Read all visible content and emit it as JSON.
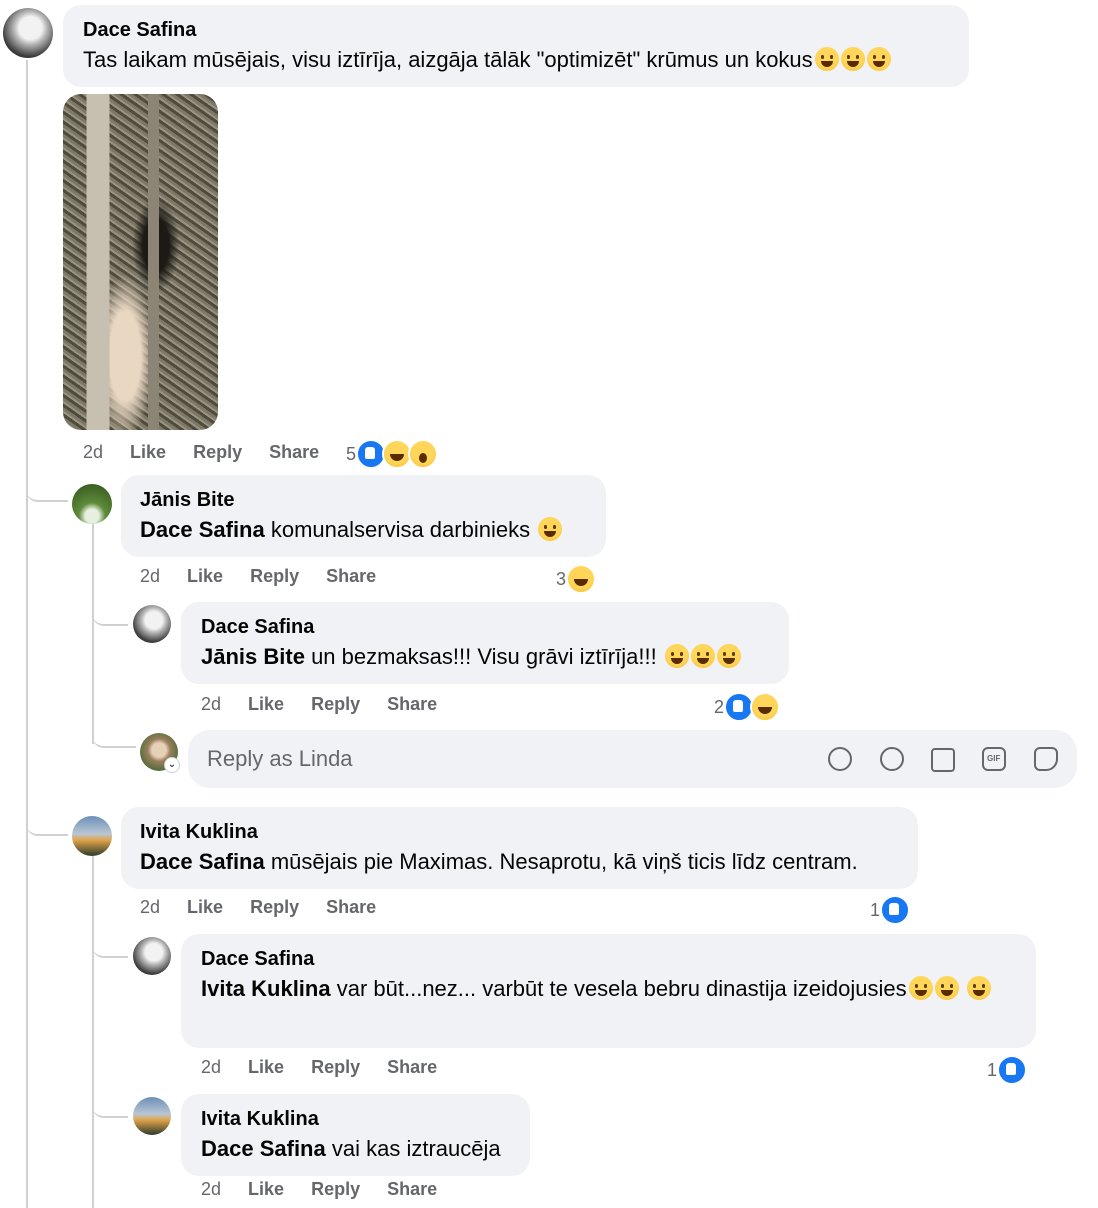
{
  "comments": [
    {
      "author": "Dace Safina",
      "text": "Tas laikam mūsējais, visu iztīrīja, aizgāja tālāk \"optimizēt\" krūmus un kokus",
      "emoji": [
        "grinning-face",
        "grinning-face",
        "grinning-face"
      ],
      "time": "2d",
      "like": "Like",
      "reply": "Share",
      "reply_label": "Reply",
      "reaction_count": "5",
      "reactions": [
        "like",
        "haha",
        "wow"
      ]
    },
    {
      "author": "Jānis Bite",
      "mention": "Dace Safina",
      "text": "komunalservisa darbinieks",
      "emoji": [
        "grinning-squinting-face"
      ],
      "time": "2d",
      "like": "Like",
      "reply_label": "Reply",
      "share": "Share",
      "reaction_count": "3",
      "reactions": [
        "haha"
      ]
    },
    {
      "author": "Dace Safina",
      "mention": "Jānis Bite",
      "text": "un bezmaksas!!! Visu grāvi iztīrīja!!!",
      "emoji": [
        "rolling-on-floor-laughing",
        "rolling-on-floor-laughing",
        "rolling-on-floor-laughing"
      ],
      "time": "2d",
      "like": "Like",
      "reply_label": "Reply",
      "share": "Share",
      "reaction_count": "2",
      "reactions": [
        "like",
        "haha"
      ]
    },
    {
      "author": "Ivita Kuklina",
      "mention": "Dace Safina",
      "text": "mūsējais pie Maximas. Nesaprotu, kā viņš ticis līdz centram.",
      "time": "2d",
      "like": "Like",
      "reply_label": "Reply",
      "share": "Share",
      "reaction_count": "1",
      "reactions": [
        "like"
      ]
    },
    {
      "author": "Dace Safina",
      "mention": "Ivita Kuklina",
      "text": "var būt...nez... varbūt te vesela bebru dinastija izeidojusies",
      "emoji": [
        "rolling-on-floor-laughing",
        "rolling-on-floor-laughing",
        "rolling-on-floor-laughing"
      ],
      "time": "2d",
      "like": "Like",
      "reply_label": "Reply",
      "share": "Share",
      "reaction_count": "1",
      "reactions": [
        "like"
      ]
    },
    {
      "author": "Ivita Kuklina",
      "mention": "Dace Safina",
      "text": "vai kas iztraucēja",
      "time": "2d",
      "like": "Like",
      "reply_label": "Reply",
      "share": "Share"
    }
  ],
  "reply_box": {
    "placeholder": "Reply as Linda",
    "tools": [
      "avatar-sticker-icon",
      "emoji-icon",
      "camera-icon",
      "gif-icon",
      "sticker-icon"
    ],
    "gif_label": "GIF"
  },
  "colors": {
    "bubble": "#f0f2f5",
    "meta": "#65676b",
    "like_blue": "#1877f2",
    "thread": "#ced0d4"
  }
}
